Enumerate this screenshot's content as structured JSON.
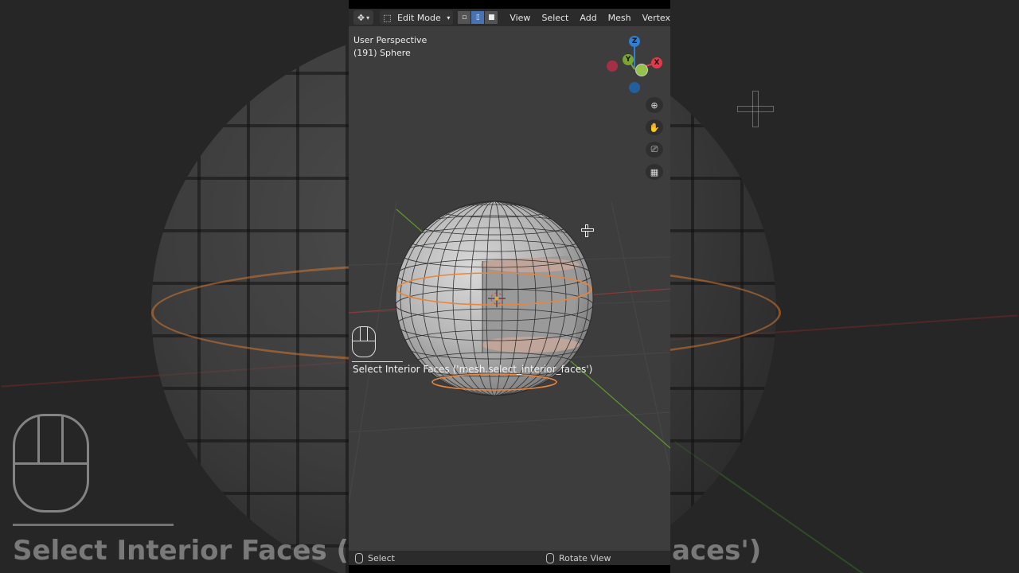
{
  "header": {
    "mode_label": "Edit Mode",
    "menus": [
      "View",
      "Select",
      "Add",
      "Mesh",
      "Vertex"
    ]
  },
  "viewport": {
    "perspective": "User Perspective",
    "object": "(191) Sphere"
  },
  "gizmo": {
    "x": "X",
    "y": "Y",
    "z": "Z",
    "colors": {
      "x": "#e5384c",
      "y": "#7aa52f",
      "z": "#2f7fd3"
    }
  },
  "nav_icons": [
    "zoom-icon",
    "hand-pan-icon",
    "camera-icon",
    "grid-ortho-icon"
  ],
  "operator": {
    "text": "Select Interior Faces ('mesh.select_interior_faces')"
  },
  "status": {
    "left": "Select",
    "right": "Rotate View"
  },
  "background": {
    "text_left": "Select Interior Faces ('n",
    "text_right": "aces')"
  },
  "colors": {
    "accent": "#4772b3",
    "selection": "#e8853a"
  }
}
